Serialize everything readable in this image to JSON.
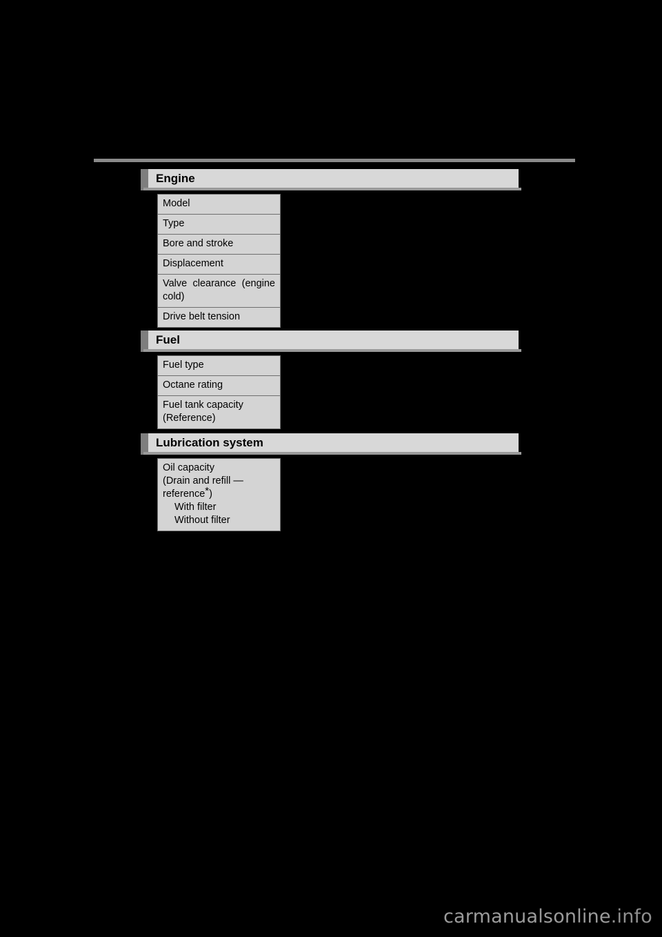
{
  "page": {
    "background_color": "#000000",
    "rule_color": "#8a8a8a",
    "header_bar_color": "#d8d8d8",
    "header_accent_color": "#7e7e7e",
    "cell_color": "#d4d4d4",
    "cell_border_color": "#6e6e6e"
  },
  "sections": [
    {
      "id": "engine",
      "title": "Engine",
      "rows": [
        {
          "label": "Model"
        },
        {
          "label": "Type"
        },
        {
          "label": "Bore and stroke"
        },
        {
          "label": "Displacement"
        },
        {
          "label": "Valve clearance (engine cold)"
        },
        {
          "label": "Drive belt tension"
        }
      ]
    },
    {
      "id": "fuel",
      "title": "Fuel",
      "rows": [
        {
          "label": "Fuel type"
        },
        {
          "label": "Octane rating"
        },
        {
          "label": "Fuel tank capacity (Reference)"
        }
      ]
    },
    {
      "id": "lubrication",
      "title": "Lubrication system",
      "rows": [
        {
          "label": "Oil capacity",
          "line2": "(Drain and refill —",
          "line3_prefix": "reference",
          "line3_star": "*",
          "line3_suffix": ")",
          "sub1": "With filter",
          "sub2": "Without filter"
        }
      ]
    }
  ],
  "watermark": {
    "text": "carmanualsonline",
    "suffix": ".info"
  }
}
